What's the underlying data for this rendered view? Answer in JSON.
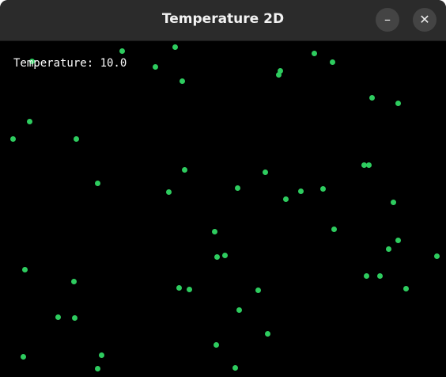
{
  "window": {
    "title": "Temperature 2D",
    "minimize_icon": "minimize-icon",
    "close_icon": "close-icon"
  },
  "hud": {
    "temperature_label": "Temperature: 10.0"
  },
  "particles": {
    "count": 49,
    "color": "#2ecc5f"
  }
}
